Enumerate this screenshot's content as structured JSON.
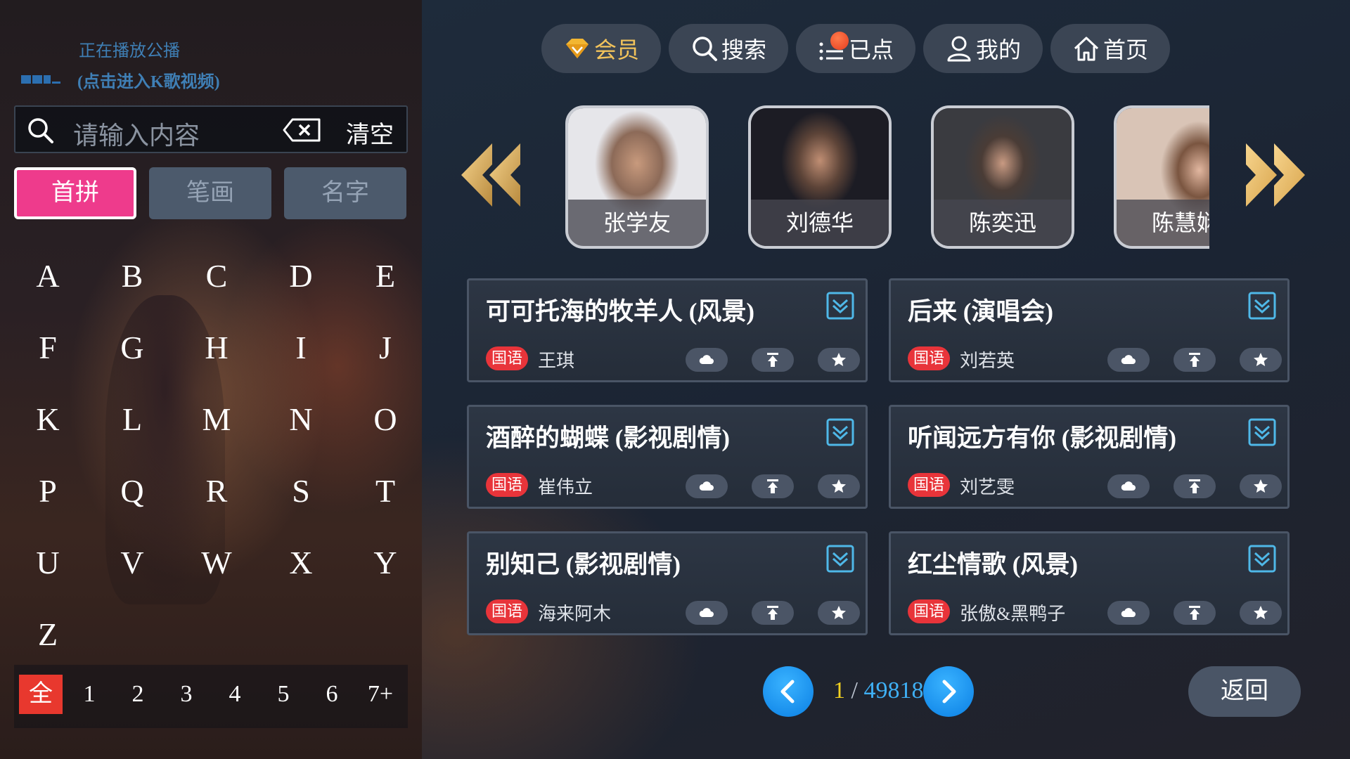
{
  "now_playing": {
    "line1": "正在播放公播",
    "line2": "(点击进入K歌视频)"
  },
  "search": {
    "placeholder": "请输入内容",
    "clear_label": "清空"
  },
  "mode_tabs": [
    "首拼",
    "笔画",
    "名字"
  ],
  "letters": [
    "A",
    "B",
    "C",
    "D",
    "E",
    "F",
    "G",
    "H",
    "I",
    "J",
    "K",
    "L",
    "M",
    "N",
    "O",
    "P",
    "Q",
    "R",
    "S",
    "T",
    "U",
    "V",
    "W",
    "X",
    "Y",
    "Z"
  ],
  "word_counts": [
    "全",
    "1",
    "2",
    "3",
    "4",
    "5",
    "6",
    "7+"
  ],
  "nav": {
    "vip": "会员",
    "search": "搜索",
    "ordered": "已点",
    "mine": "我的",
    "home": "首页"
  },
  "artists": [
    "张学友",
    "刘德华",
    "陈奕迅",
    "陈慧娴"
  ],
  "songs": [
    {
      "title": "可可托海的牧羊人 (风景)",
      "lang": "国语",
      "singer": "王琪"
    },
    {
      "title": "后来 (演唱会)",
      "lang": "国语",
      "singer": "刘若英"
    },
    {
      "title": "酒醉的蝴蝶 (影视剧情)",
      "lang": "国语",
      "singer": "崔伟立"
    },
    {
      "title": "听闻远方有你 (影视剧情)",
      "lang": "国语",
      "singer": "刘艺雯"
    },
    {
      "title": "别知己 (影视剧情)",
      "lang": "国语",
      "singer": "海来阿木"
    },
    {
      "title": "红尘情歌 (风景)",
      "lang": "国语",
      "singer": "张傲&黑鸭子"
    }
  ],
  "pager": {
    "current": "1",
    "separator": " / ",
    "total": "49818"
  },
  "back_label": "返回",
  "colors": {
    "accent_pink": "#ee3b8c",
    "badge_red": "#e8343a",
    "page_blue": "#3fb0f5",
    "page_yellow": "#f1d020",
    "vip_gold": "#f2c35b"
  }
}
